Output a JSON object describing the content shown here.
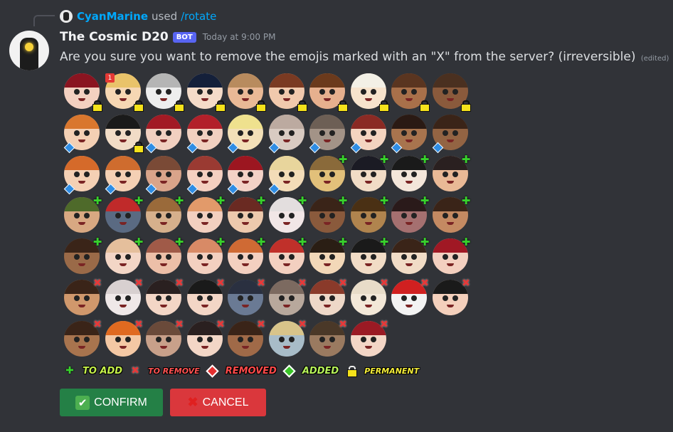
{
  "reply": {
    "user": "CyanMarine",
    "used": "used",
    "command": "/rotate"
  },
  "message": {
    "author": "The Cosmic D20",
    "bot_tag": "BOT",
    "timestamp": "Today at 9:00 PM",
    "content": "Are you sure you want to remove the emojis marked with an \"X\" from the server? (irreversible)",
    "edited": "(edited)"
  },
  "emoji_rows": [
    [
      {
        "skin": "#f3d0c0",
        "hair": "#8a1420",
        "mark": "lock",
        "badge": ""
      },
      {
        "skin": "#f6d7b3",
        "hair": "#e9c36a",
        "mark": "lock",
        "badge": "1"
      },
      {
        "skin": "#eeeeee",
        "hair": "#b5b5b5",
        "mark": "lock",
        "badge": ""
      },
      {
        "skin": "#f4dbc8",
        "hair": "#14203a",
        "mark": "lock",
        "badge": ""
      },
      {
        "skin": "#e9b996",
        "hair": "#b88b5e",
        "mark": "lock",
        "badge": ""
      },
      {
        "skin": "#f1c9ad",
        "hair": "#7a3a22",
        "mark": "lock",
        "badge": ""
      },
      {
        "skin": "#e6b08e",
        "hair": "#6b3a1c",
        "mark": "lock",
        "badge": ""
      },
      {
        "skin": "#f7e3cc",
        "hair": "#f3f0e6",
        "mark": "lock",
        "badge": ""
      },
      {
        "skin": "#a8704a",
        "hair": "#5a3520",
        "mark": "lock",
        "badge": ""
      },
      {
        "skin": "#8a5a3c",
        "hair": "#4a3020",
        "mark": "lock",
        "badge": ""
      }
    ],
    [
      {
        "skin": "#f4d0b4",
        "hair": "#d9772e",
        "mark": "diamond"
      },
      {
        "skin": "#f1dcc6",
        "hair": "#1a1a1a",
        "mark": "lock"
      },
      {
        "skin": "#f1d0c0",
        "hair": "#a21a24",
        "mark": "diamond"
      },
      {
        "skin": "#f1d0c0",
        "hair": "#b2202a",
        "mark": "diamond"
      },
      {
        "skin": "#f3e0b8",
        "hair": "#efe18e",
        "mark": "diamond"
      },
      {
        "skin": "#d9cbc2",
        "hair": "#bcaaa0",
        "mark": "diamond"
      },
      {
        "skin": "#a39387",
        "hair": "#6d5f55",
        "mark": "diamond"
      },
      {
        "skin": "#f4d4c0",
        "hair": "#8a2a24",
        "mark": "diamond"
      },
      {
        "skin": "#a8744e",
        "hair": "#2a1a14",
        "mark": "diamond"
      },
      {
        "skin": "#936443",
        "hair": "#3a2418",
        "mark": "diamond"
      }
    ],
    [
      {
        "skin": "#f4d0b4",
        "hair": "#d56a2a",
        "mark": "diamond"
      },
      {
        "skin": "#f4d0b4",
        "hair": "#cf6c2e",
        "mark": "diamond"
      },
      {
        "skin": "#d9a48a",
        "hair": "#7a4a36",
        "mark": "diamond"
      },
      {
        "skin": "#f4d0c0",
        "hair": "#9a3a32",
        "mark": "diamond"
      },
      {
        "skin": "#f3d2c6",
        "hair": "#9c1620",
        "mark": "diamond"
      },
      {
        "skin": "#f3dcb8",
        "hair": "#e8d59c",
        "mark": "diamond"
      },
      {
        "skin": "#e2c07a",
        "hair": "#8a6a3a",
        "mark": "plus"
      },
      {
        "skin": "#f1dcc6",
        "hair": "#1b1b24",
        "mark": "plus"
      },
      {
        "skin": "#f3e6da",
        "hair": "#1a1a1a",
        "mark": "plus"
      },
      {
        "skin": "#e9b996",
        "hair": "#2a2020",
        "mark": "plus"
      }
    ],
    [
      {
        "skin": "#d8a882",
        "hair": "#4e6a2a",
        "mark": "plus"
      },
      {
        "skin": "#5a6a82",
        "hair": "#c02a2a",
        "mark": "plus"
      },
      {
        "skin": "#d6b08c",
        "hair": "#9a6a3a",
        "mark": "plus"
      },
      {
        "skin": "#f3d0c0",
        "hair": "#e29a6a",
        "mark": "plus"
      },
      {
        "skin": "#edc9ad",
        "hair": "#6a2a22",
        "mark": "plus"
      },
      {
        "skin": "#f1e6e6",
        "hair": "#e3dede",
        "mark": "plus"
      },
      {
        "skin": "#8a5a3c",
        "hair": "#3a2418",
        "mark": "plus"
      },
      {
        "skin": "#b0844e",
        "hair": "#4a3014",
        "mark": "plus"
      },
      {
        "skin": "#a57070",
        "hair": "#2a1a1a",
        "mark": "plus"
      },
      {
        "skin": "#c48a62",
        "hair": "#3a2418",
        "mark": "plus"
      }
    ],
    [
      {
        "skin": "#9a6a48",
        "hair": "#3a2418",
        "mark": "plus"
      },
      {
        "skin": "#f3d6c6",
        "hair": "#e5bf9c",
        "mark": "plus"
      },
      {
        "skin": "#ecbfa8",
        "hair": "#a05a48",
        "mark": "plus"
      },
      {
        "skin": "#f3d0c0",
        "hair": "#d88a66",
        "mark": "plus"
      },
      {
        "skin": "#f3d0c0",
        "hair": "#cf6a34",
        "mark": "plus"
      },
      {
        "skin": "#f3d0c0",
        "hair": "#c0302a",
        "mark": "plus"
      },
      {
        "skin": "#f3d8b8",
        "hair": "#2a1e14",
        "mark": "plus"
      },
      {
        "skin": "#f1dcc6",
        "hair": "#1a1a1a",
        "mark": "plus"
      },
      {
        "skin": "#f1dcc6",
        "hair": "#3a2418",
        "mark": "plus"
      },
      {
        "skin": "#f3d0c0",
        "hair": "#a01824",
        "mark": "plus"
      }
    ],
    [
      {
        "skin": "#d0986c",
        "hair": "#3a2418",
        "mark": "x"
      },
      {
        "skin": "#efe8e8",
        "hair": "#d8d0d0",
        "mark": "x"
      },
      {
        "skin": "#f3d6c6",
        "hair": "#2a2020",
        "mark": "x"
      },
      {
        "skin": "#f3d6c6",
        "hair": "#1a1a1a",
        "mark": "x"
      },
      {
        "skin": "#6a7a94",
        "hair": "#2a3040",
        "mark": "x"
      },
      {
        "skin": "#b8a89c",
        "hair": "#7c6a60",
        "mark": "x"
      },
      {
        "skin": "#eed8c8",
        "hair": "#8a3a2a",
        "mark": "x"
      },
      {
        "skin": "#f3e8d8",
        "hair": "#e8dcc8",
        "mark": "x"
      },
      {
        "skin": "#f3f3f3",
        "hair": "#d02020",
        "mark": "x"
      },
      {
        "skin": "#f4d0bc",
        "hair": "#1a1a1a",
        "mark": "x"
      }
    ],
    [
      {
        "skin": "#a8744e",
        "hair": "#3a2418",
        "mark": "x"
      },
      {
        "skin": "#f4c8a4",
        "hair": "#e06a20",
        "mark": "x"
      },
      {
        "skin": "#c8a08a",
        "hair": "#6a4a3a",
        "mark": "x"
      },
      {
        "skin": "#f3d6c6",
        "hair": "#2a2020",
        "mark": "x"
      },
      {
        "skin": "#a06a48",
        "hair": "#3a2418",
        "mark": "x"
      },
      {
        "skin": "#a8bcc8",
        "hair": "#d8c48a",
        "mark": "x"
      },
      {
        "skin": "#9a7a60",
        "hair": "#4a3828",
        "mark": "x"
      },
      {
        "skin": "#f3d6c6",
        "hair": "#9a1a24",
        "mark": "x"
      }
    ]
  ],
  "legend": {
    "add_symbol": "✚",
    "add_label": "TO ADD",
    "remove_symbol": "✖",
    "remove_label": "TO REMOVE",
    "removed_label": "REMOVED",
    "added_label": "ADDED",
    "permanent_label": "PERMANENT",
    "colors": {
      "add": "#c4f04a",
      "remove": "#ff5252",
      "removed": "#ff4a4a",
      "added": "#b6f25a",
      "permanent": "#f6ef3a"
    }
  },
  "buttons": {
    "confirm_icon": "✔",
    "confirm_label": "CONFIRM",
    "cancel_icon": "✖",
    "cancel_label": "CANCEL",
    "colors": {
      "confirm": "#248046",
      "cancel": "#da373c"
    }
  }
}
